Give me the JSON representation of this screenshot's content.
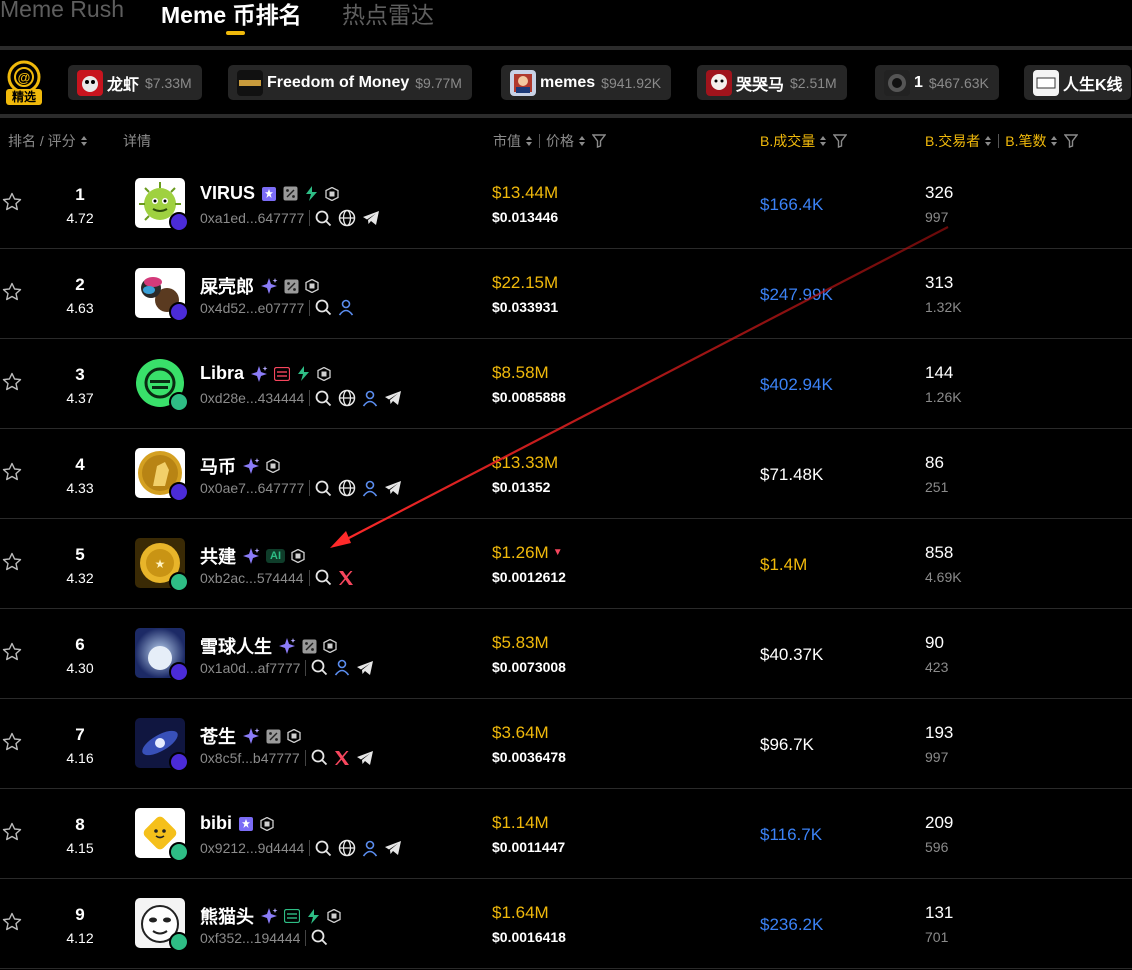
{
  "nav": {
    "tabs": [
      {
        "label": "Meme Rush",
        "active": false
      },
      {
        "label": "Meme 币排名",
        "active": true
      },
      {
        "label": "热点雷达",
        "active": false
      }
    ]
  },
  "featured_label": "精选",
  "chips": [
    {
      "name": "龙虾",
      "market_cap": "$7.33M"
    },
    {
      "name": "Freedom of Money",
      "market_cap": "$9.77M"
    },
    {
      "name": "memes",
      "market_cap": "$941.92K"
    },
    {
      "name": "哭哭马",
      "market_cap": "$2.51M"
    },
    {
      "name": "1",
      "market_cap": "$467.63K"
    },
    {
      "name": "人生K线",
      "market_cap": ""
    }
  ],
  "columns": {
    "rank_score": "排名 / 评分",
    "details": "详情",
    "market_cap": "市值",
    "price": "价格",
    "volume": "B.成交量",
    "traders": "B.交易者",
    "txns": "B.笔数"
  },
  "colors": {
    "accent": "#f0b90b",
    "blue": "#3b82f6",
    "muted": "#8b8b8b",
    "red": "#f6465d",
    "green": "#2ebd85"
  },
  "rows": [
    {
      "rank": "1",
      "score": "4.72",
      "name": "VIRUS",
      "address": "0xa1ed...647777",
      "market_cap": "$13.44M",
      "price": "$0.013446",
      "volume": "$166.4K",
      "volume_color": "blue",
      "traders": "326",
      "txns": "997",
      "badges": [
        "verified-icon",
        "percent-icon",
        "lightning-icon",
        "chip-icon"
      ],
      "links": [
        "search-icon",
        "globe-icon",
        "telegram-icon"
      ]
    },
    {
      "rank": "2",
      "score": "4.63",
      "name": "屎壳郎",
      "address": "0x4d52...e07777",
      "market_cap": "$22.15M",
      "price": "$0.033931",
      "volume": "$247.99K",
      "volume_color": "blue",
      "traders": "313",
      "txns": "1.32K",
      "badges": [
        "sparkle-icon",
        "percent-icon",
        "chip-icon"
      ],
      "links": [
        "search-icon",
        "user-icon"
      ]
    },
    {
      "rank": "3",
      "score": "4.37",
      "name": "Libra",
      "address": "0xd28e...434444",
      "market_cap": "$8.58M",
      "price": "$0.0085888",
      "volume": "$402.94K",
      "volume_color": "blue",
      "traders": "144",
      "txns": "1.26K",
      "badges": [
        "sparkle-icon",
        "red-badge-icon",
        "lightning-icon",
        "chip-icon"
      ],
      "links": [
        "search-icon",
        "globe-icon",
        "user-icon",
        "telegram-icon"
      ]
    },
    {
      "rank": "4",
      "score": "4.33",
      "name": "马币",
      "address": "0x0ae7...647777",
      "market_cap": "$13.33M",
      "price": "$0.01352",
      "volume": "$71.48K",
      "volume_color": "white",
      "traders": "86",
      "txns": "251",
      "badges": [
        "sparkle-icon",
        "chip-icon"
      ],
      "links": [
        "search-icon",
        "globe-icon",
        "user-icon",
        "telegram-icon"
      ]
    },
    {
      "rank": "5",
      "score": "4.32",
      "name": "共建",
      "address": "0xb2ac...574444",
      "market_cap": "$1.26M",
      "price": "$0.0012612",
      "volume": "$1.4M",
      "volume_color": "gold",
      "traders": "858",
      "txns": "4.69K",
      "badges": [
        "sparkle-icon",
        "ai-badge",
        "chip-icon"
      ],
      "links": [
        "search-icon",
        "x-icon"
      ],
      "ai_label": "AI",
      "down": true
    },
    {
      "rank": "6",
      "score": "4.30",
      "name": "雪球人生",
      "address": "0x1a0d...af7777",
      "market_cap": "$5.83M",
      "price": "$0.0073008",
      "volume": "$40.37K",
      "volume_color": "white",
      "traders": "90",
      "txns": "423",
      "badges": [
        "sparkle-icon",
        "percent-icon",
        "chip-icon"
      ],
      "links": [
        "search-icon",
        "user-icon",
        "telegram-icon"
      ]
    },
    {
      "rank": "7",
      "score": "4.16",
      "name": "苍生",
      "address": "0x8c5f...b47777",
      "market_cap": "$3.64M",
      "price": "$0.0036478",
      "volume": "$96.7K",
      "volume_color": "white",
      "traders": "193",
      "txns": "997",
      "badges": [
        "sparkle-icon",
        "percent-icon",
        "chip-icon"
      ],
      "links": [
        "search-icon",
        "x-icon",
        "telegram-icon"
      ]
    },
    {
      "rank": "8",
      "score": "4.15",
      "name": "bibi",
      "address": "0x9212...9d4444",
      "market_cap": "$1.14M",
      "price": "$0.0011447",
      "volume": "$116.7K",
      "volume_color": "blue",
      "traders": "209",
      "txns": "596",
      "badges": [
        "verified-icon",
        "chip-icon"
      ],
      "links": [
        "search-icon",
        "globe-icon",
        "user-icon",
        "telegram-icon"
      ]
    },
    {
      "rank": "9",
      "score": "4.12",
      "name": "熊猫头",
      "address": "0xf352...194444",
      "market_cap": "$1.64M",
      "price": "$0.0016418",
      "volume": "$236.2K",
      "volume_color": "blue",
      "traders": "131",
      "txns": "701",
      "badges": [
        "sparkle-icon",
        "green-badge-icon",
        "lightning-icon",
        "chip-icon"
      ],
      "links": [
        "search-icon"
      ]
    }
  ]
}
